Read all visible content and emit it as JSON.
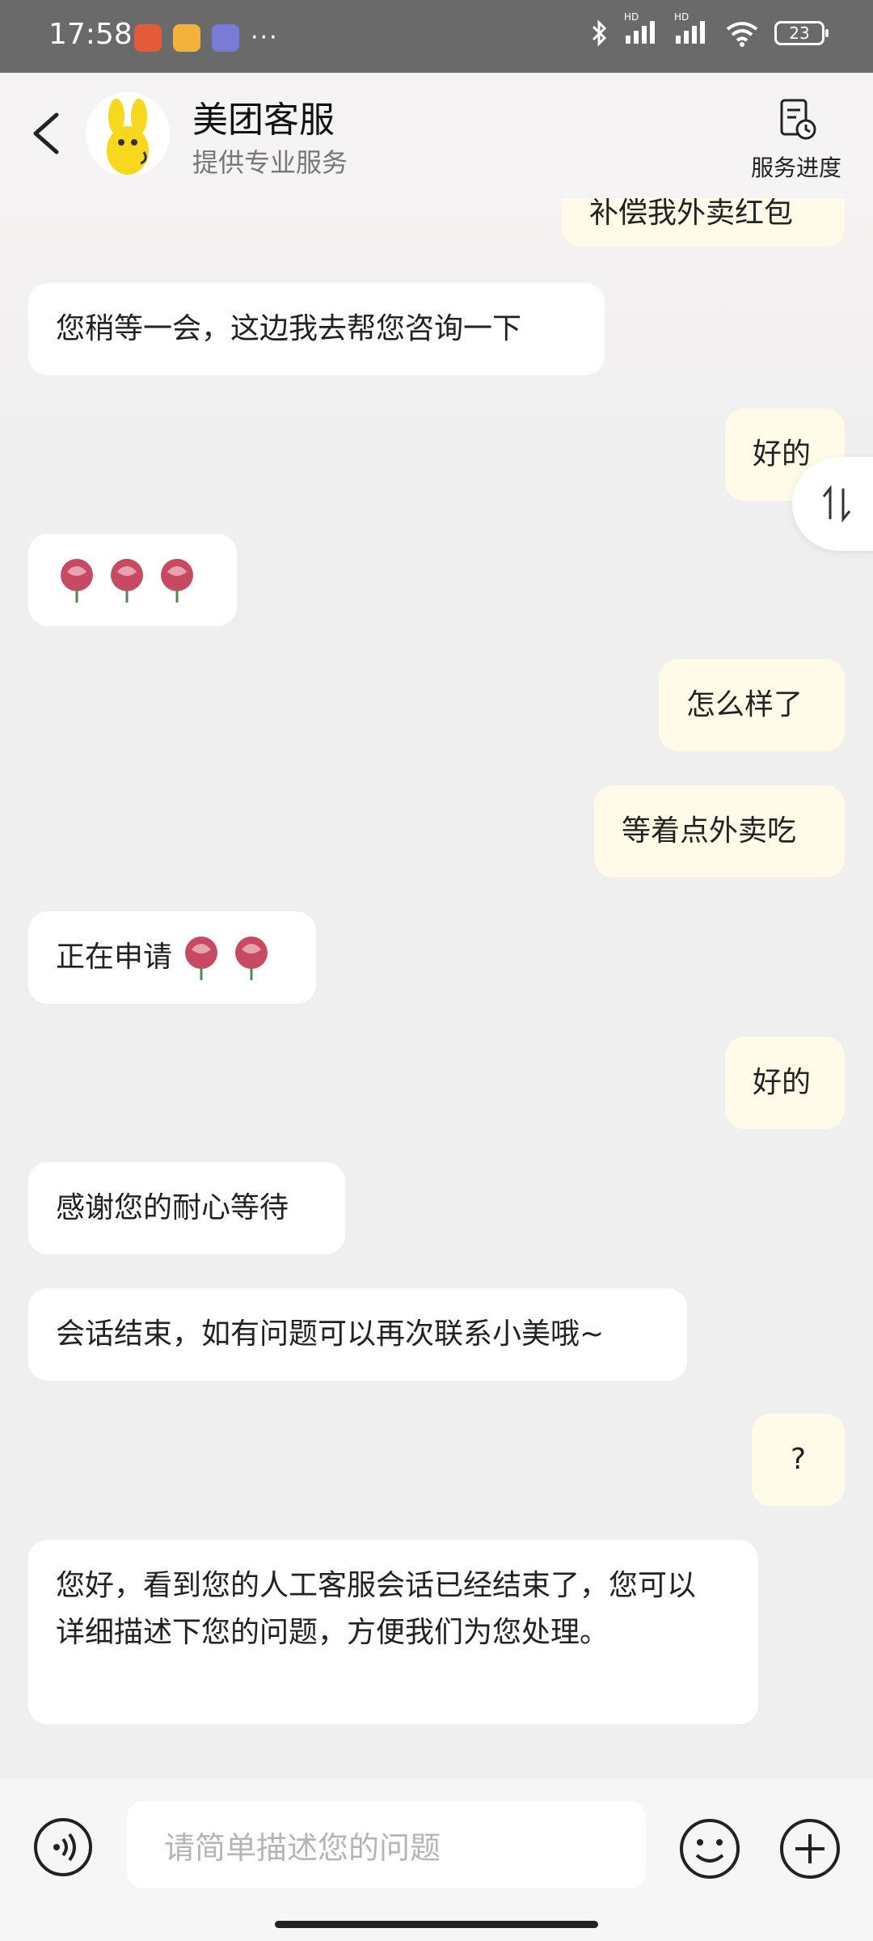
{
  "status": {
    "time": "17:58",
    "battery": "23",
    "hd1": "HD",
    "hd2": "HD",
    "more": "···"
  },
  "header": {
    "title": "美团客服",
    "subtitle": "提供专业服务",
    "progress_label": "服务进度"
  },
  "messages": [
    {
      "side": "right",
      "text": "补偿我外卖红包"
    },
    {
      "side": "left",
      "text": "您稍等一会，这边我去帮您咨询一下"
    },
    {
      "side": "right",
      "text": "好的"
    },
    {
      "side": "left",
      "emoji": "rose x3"
    },
    {
      "side": "right",
      "text": "怎么样了"
    },
    {
      "side": "right",
      "text": "等着点外卖吃"
    },
    {
      "side": "left",
      "text": "正在申请",
      "emoji": "rose x2"
    },
    {
      "side": "right",
      "text": "好的"
    },
    {
      "side": "left",
      "text": "感谢您的耐心等待"
    },
    {
      "side": "left",
      "text": "会话结束，如有问题可以再次联系小美哦~"
    },
    {
      "side": "right",
      "text": "?"
    },
    {
      "side": "left",
      "text": "您好，看到您的人工客服会话已经结束了，您可以详细描述下您的问题，方便我们为您处理。"
    }
  ],
  "input": {
    "placeholder": "请简单描述您的问题"
  },
  "icons": {
    "back": "back-icon",
    "progress": "service-progress-icon",
    "scroll": "scroll-toggle-icon",
    "voice": "voice-icon",
    "emoji": "emoji-icon",
    "plus": "plus-icon",
    "rose": "rose-emoji"
  },
  "colors": {
    "left_bubble": "#ffffff",
    "right_bubble": "#fffbe8",
    "background": "#efefef",
    "accent_yellow": "#f8d71f"
  }
}
